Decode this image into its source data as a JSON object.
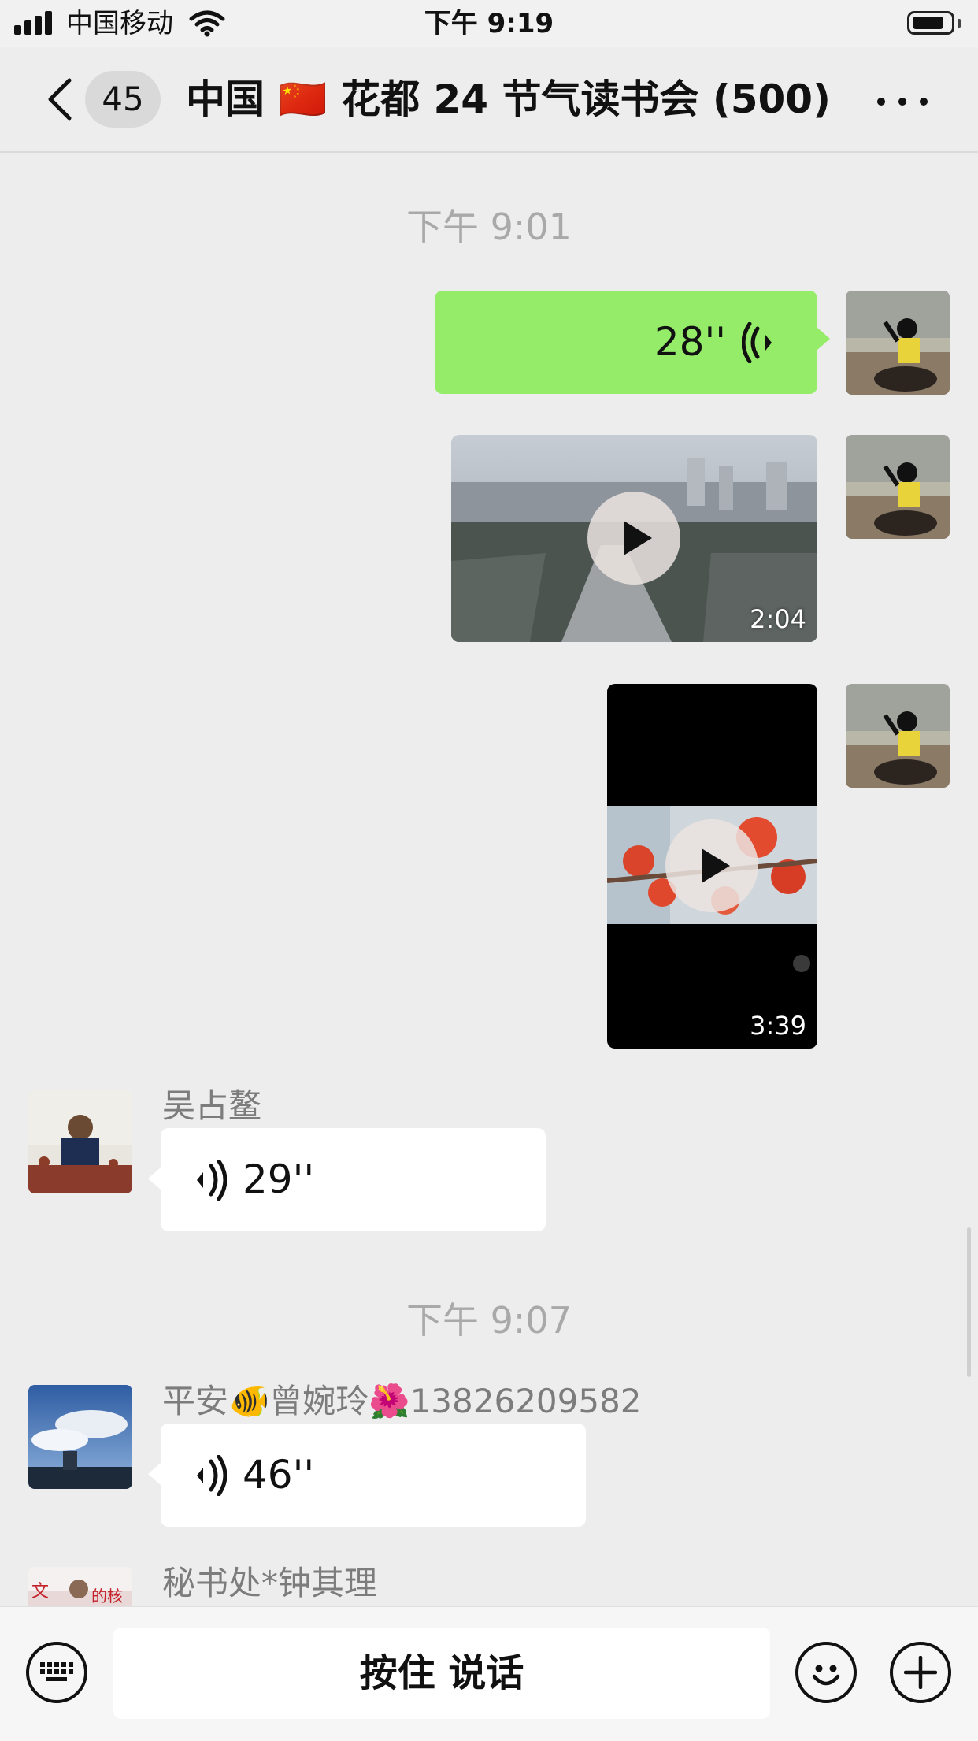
{
  "status_bar": {
    "carrier": "中国移动",
    "time": "下午 9:19"
  },
  "nav": {
    "unread_count": "45",
    "title": "中国 🇨🇳 花都 24 节气读书会 (500)"
  },
  "messages": [
    {
      "type": "time",
      "text": "下午 9:01"
    },
    {
      "type": "voice",
      "side": "right",
      "duration": "28''"
    },
    {
      "type": "video",
      "side": "right",
      "duration": "2:04"
    },
    {
      "type": "video",
      "side": "right",
      "duration": "3:39"
    },
    {
      "type": "voice",
      "side": "left",
      "sender": "吴占鳌",
      "duration": "29''"
    },
    {
      "type": "time",
      "text": "下午 9:07"
    },
    {
      "type": "voice",
      "side": "left",
      "sender": "平安🐠曾婉玲🌺13826209582",
      "duration": "46''"
    },
    {
      "type": "partial",
      "side": "left",
      "sender": "秘书处*钟其理"
    }
  ],
  "input_bar": {
    "hold_to_talk": "按住 说话"
  },
  "icons": {
    "back": "chevron-left-icon",
    "more": "more-dots-icon",
    "voice_wave": "voice-wave-icon",
    "play": "play-icon",
    "keyboard": "keyboard-icon",
    "emoji": "emoji-icon",
    "plus": "plus-icon"
  },
  "colors": {
    "background": "#ededed",
    "bubble_self": "#95ec69",
    "bubble_other": "#ffffff",
    "time_text": "#a9a9a9",
    "sender_text": "#7c7c7c"
  }
}
